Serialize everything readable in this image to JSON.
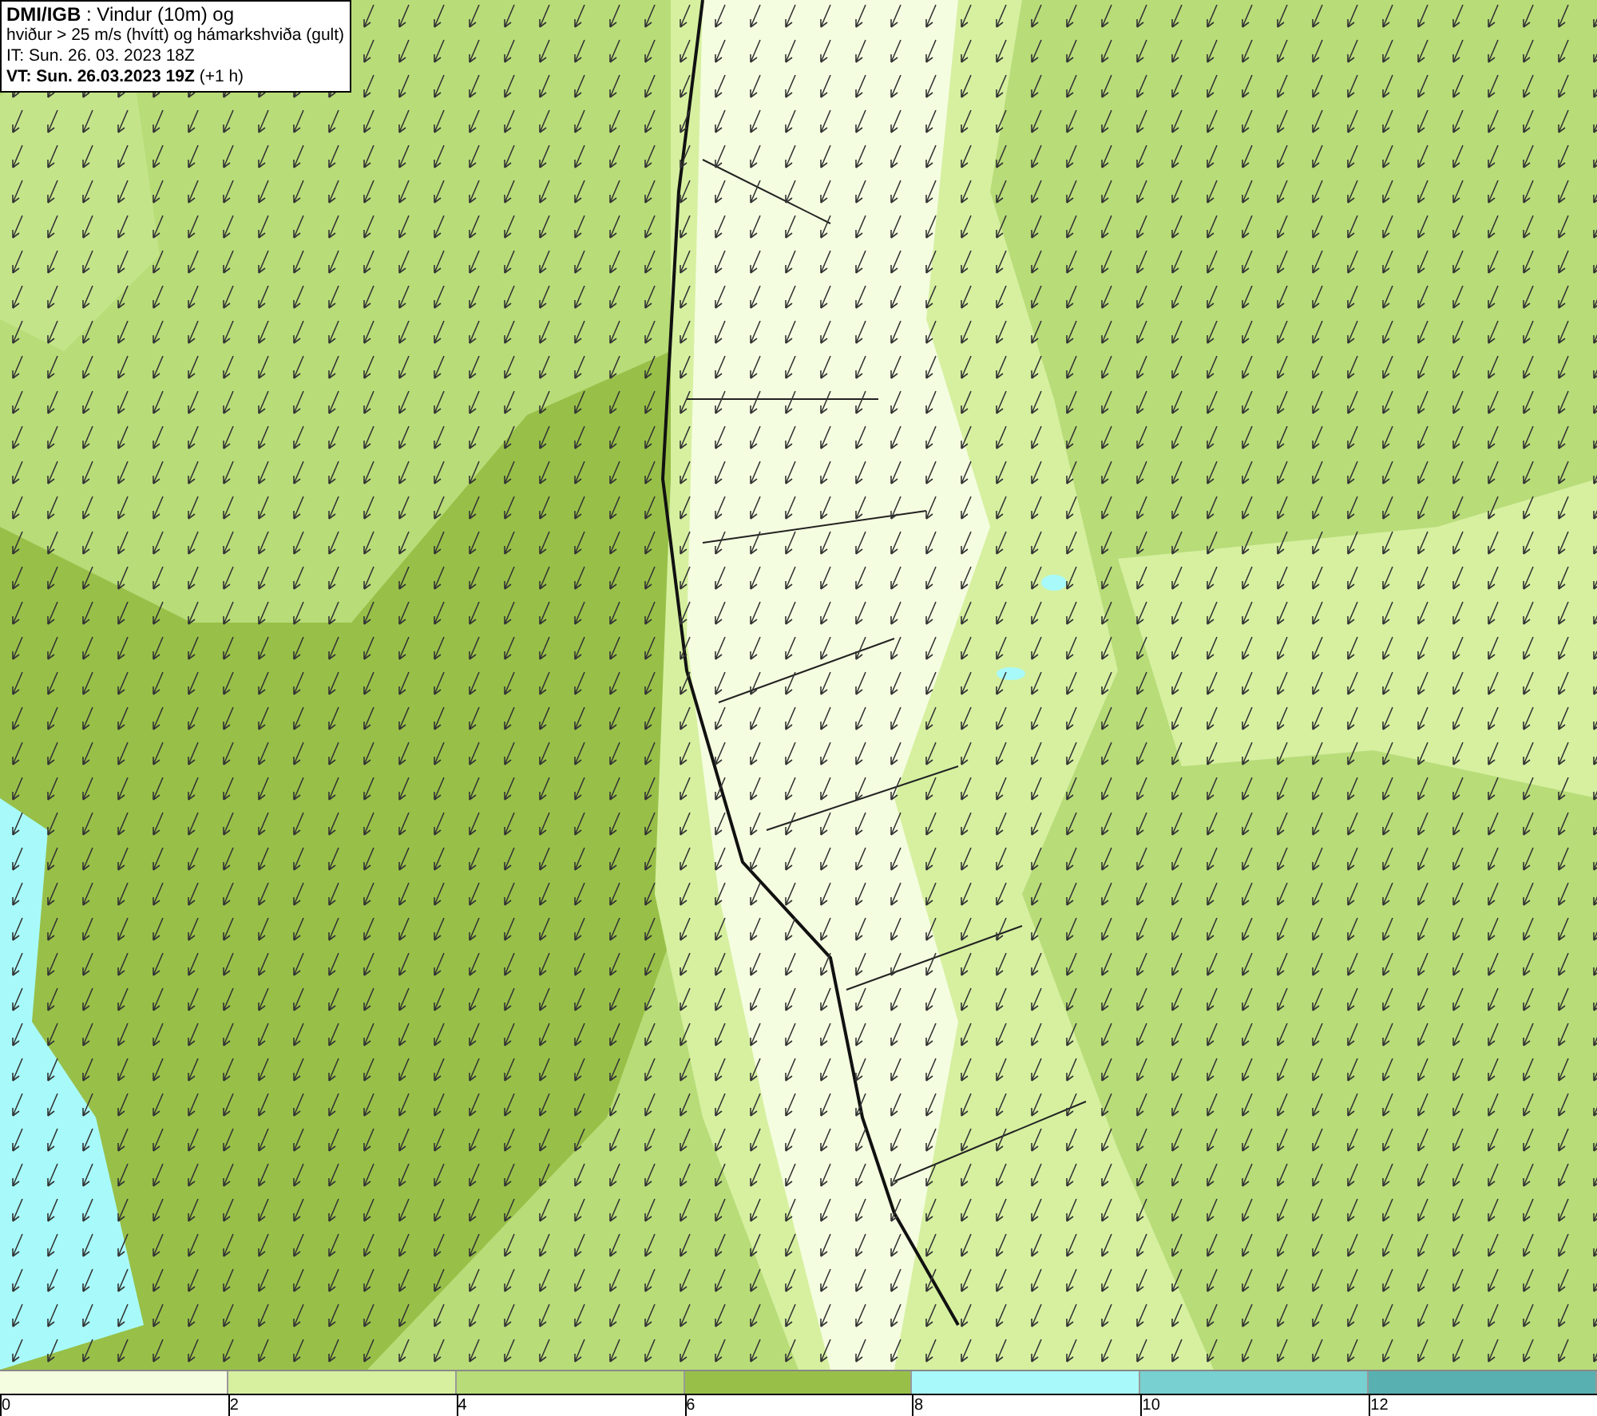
{
  "header": {
    "lines": [
      "**DMI/IGB** : Vindur (10m) og",
      "hviður > 25 m/s (hvítt) og hámarkshviða (gult)",
      "IT: Sun. 26. 03. 2023 18Z",
      "**VT: Sun. 26.03.2023 19Z** (+1 h)"
    ]
  },
  "legend": {
    "bins": [
      {
        "color": "#f5fde0",
        "label": "0"
      },
      {
        "color": "#d6f0a0",
        "label": "2"
      },
      {
        "color": "#b8dc78",
        "label": "4"
      },
      {
        "color": "#98c048",
        "label": "6"
      },
      {
        "color": "#a8fafa",
        "label": "8"
      },
      {
        "color": "#78d0d0",
        "label": "10"
      },
      {
        "color": "#58b0b0",
        "label": "12"
      }
    ]
  }
}
